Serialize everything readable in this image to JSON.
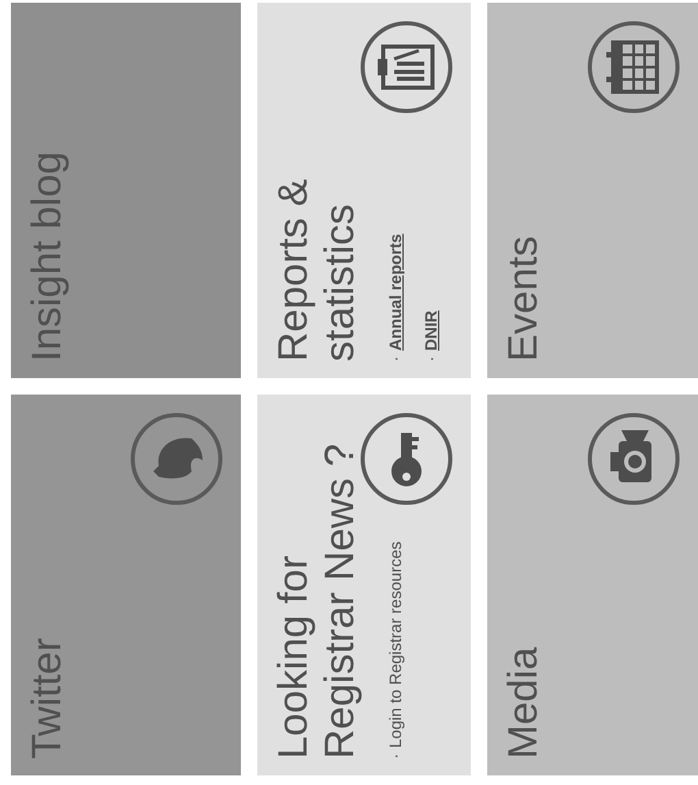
{
  "tiles": [
    {
      "title": [
        "Insight blog"
      ],
      "color": "#8f8f8f"
    },
    {
      "title": [
        "Reports &",
        "statistics"
      ],
      "color": "#e0e0e0",
      "links": [
        {
          "bullet": "·",
          "label": "Annual reports",
          "kind": "link"
        },
        {
          "bullet": "·",
          "label": "DNIR",
          "kind": "link"
        }
      ]
    },
    {
      "title": [
        "Events"
      ],
      "color": "#bdbdbd"
    },
    {
      "title": [
        "Twitter"
      ],
      "color": "#959595"
    },
    {
      "title": [
        "Looking for",
        "Registrar News ?"
      ],
      "color": "#e0e0e0",
      "links": [
        {
          "bullet": "·",
          "label": "Login to Registrar resources",
          "kind": "text"
        }
      ]
    },
    {
      "title": [
        "Media"
      ],
      "color": "#bdbdbd"
    }
  ]
}
